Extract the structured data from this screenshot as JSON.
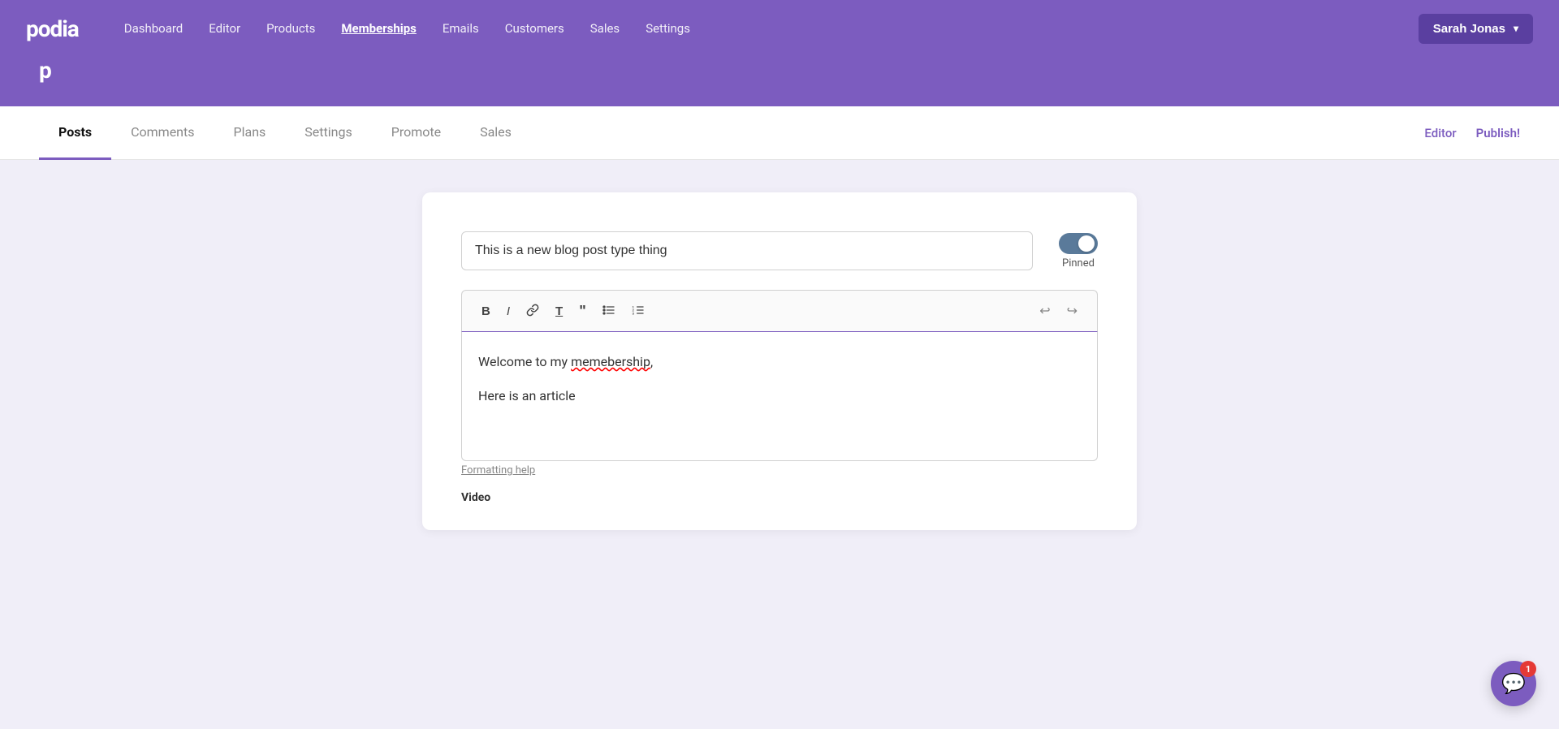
{
  "brand": {
    "logo": "podia"
  },
  "navbar": {
    "links": [
      {
        "id": "dashboard",
        "label": "Dashboard",
        "active": false
      },
      {
        "id": "editor",
        "label": "Editor",
        "active": false
      },
      {
        "id": "products",
        "label": "Products",
        "active": false
      },
      {
        "id": "memberships",
        "label": "Memberships",
        "active": true
      },
      {
        "id": "emails",
        "label": "Emails",
        "active": false
      },
      {
        "id": "customers",
        "label": "Customers",
        "active": false
      },
      {
        "id": "sales",
        "label": "Sales",
        "active": false
      },
      {
        "id": "settings",
        "label": "Settings",
        "active": false
      }
    ],
    "user_label": "Sarah Jonas",
    "user_chevron": "▾"
  },
  "page": {
    "title": "p"
  },
  "tabs": {
    "items": [
      {
        "id": "posts",
        "label": "Posts",
        "active": true
      },
      {
        "id": "comments",
        "label": "Comments",
        "active": false
      },
      {
        "id": "plans",
        "label": "Plans",
        "active": false
      },
      {
        "id": "settings",
        "label": "Settings",
        "active": false
      },
      {
        "id": "promote",
        "label": "Promote",
        "active": false
      },
      {
        "id": "sales",
        "label": "Sales",
        "active": false
      }
    ],
    "editor_link": "Editor",
    "publish_link": "Publish!"
  },
  "post_editor": {
    "title_placeholder": "This is a new blog post type thing",
    "title_value": "This is a new blog post type thing",
    "pinned": true,
    "pin_label": "Pinned",
    "toolbar": {
      "bold": "B",
      "italic": "I",
      "link": "🔗",
      "text_style": "T̲",
      "quote": "❝",
      "bullet_list": "≡",
      "ordered_list": "≡",
      "undo": "↩",
      "redo": "↪"
    },
    "content_line1": "Welcome to my memebership,",
    "content_line2": "Here is an article",
    "formatting_help": "Formatting help",
    "video_label": "Video"
  },
  "chat": {
    "badge_count": "1"
  }
}
